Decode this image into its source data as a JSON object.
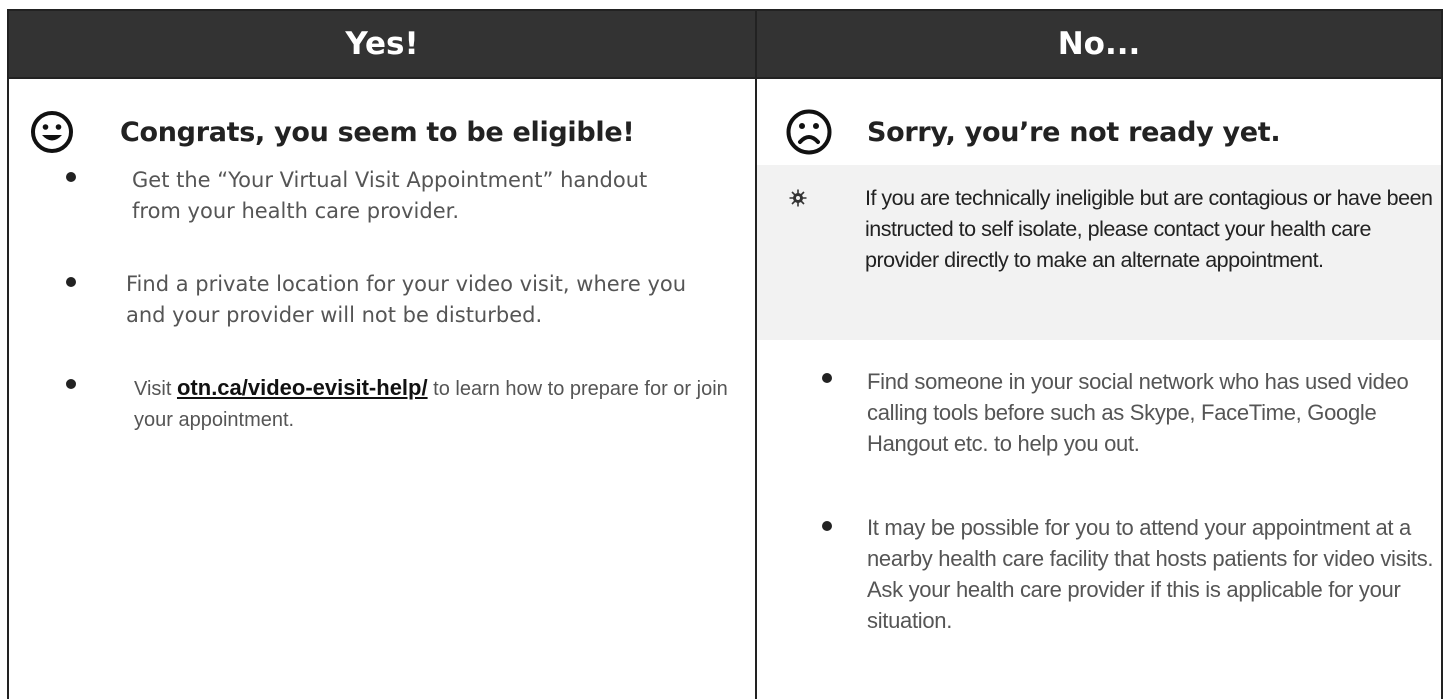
{
  "yes": {
    "header": "Yes!",
    "title": "Congrats, you seem to be eligible!",
    "items": [
      {
        "text": "Get the “Your Virtual Visit Appointment” handout from your health care provider."
      },
      {
        "text": "Find a private location for your video visit, where you and your provider will not be disturbed."
      },
      {
        "before": "Visit ",
        "link": "otn.ca/video-evisit-help/",
        "after": " to learn how to prepare for or join your appointment."
      }
    ]
  },
  "no": {
    "header": "No...",
    "title": "Sorry, you’re not ready yet.",
    "note": "If you are technically ineligible but are contagious or have been instructed to self isolate, please contact your health care provider directly to make an alternate appointment.",
    "items": [
      {
        "text": "Find someone in your social network who has used video calling tools before such as Skype, FaceTime, Google Hangout etc. to help you out."
      },
      {
        "text": "It may be possible for you to attend your appointment at a nearby health care facility that hosts patients for video visits. Ask your health care provider if this is applicable for your situation."
      }
    ]
  },
  "icons": {
    "happy": "smiley-face-icon",
    "sad": "sad-face-icon",
    "note": "virus-icon",
    "bullet": "bullet-dot"
  }
}
